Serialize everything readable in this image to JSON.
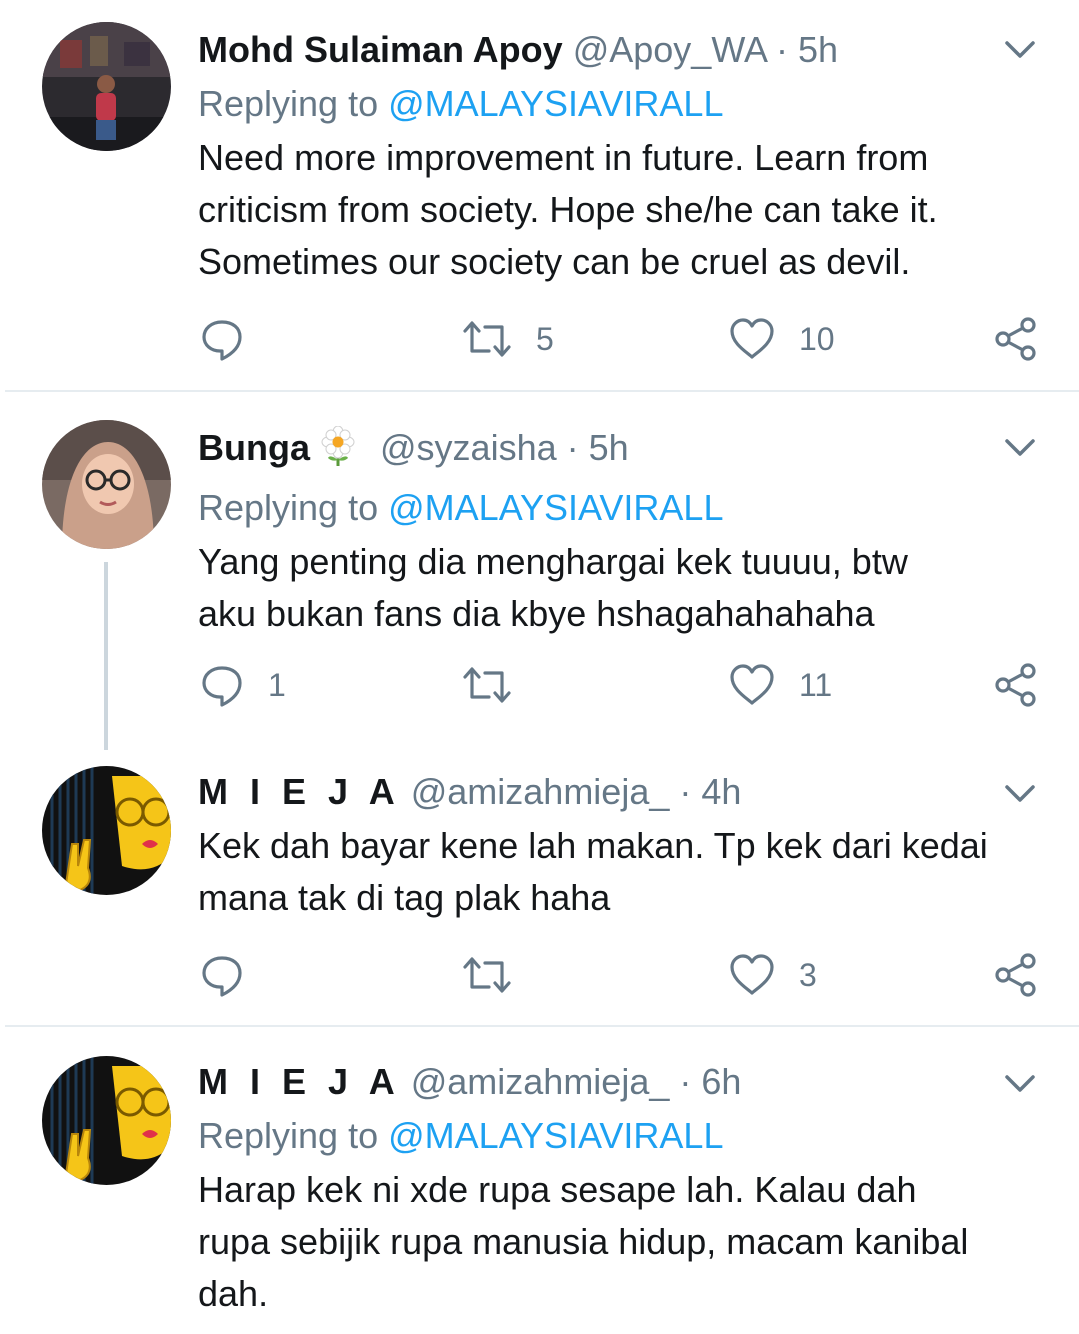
{
  "tweets": [
    {
      "name": "Mohd Sulaiman Apoy",
      "handle": "@Apoy_WA",
      "sep": "·",
      "time": "5h",
      "replying_prefix": "Replying to",
      "replying_handle": "@MALAYSIAVIRALL",
      "lines": [
        "Need more improvement in future. Learn from",
        "criticism from society. Hope she/he can take it.",
        "Sometimes our society can be cruel as devil."
      ],
      "reply_count": "",
      "retweet_count": "5",
      "like_count": "10"
    },
    {
      "name": "Bunga",
      "handle": "@syzaisha",
      "sep": "·",
      "time": "5h",
      "replying_prefix": "Replying to",
      "replying_handle": "@MALAYSIAVIRALL",
      "lines": [
        "Yang penting dia menghargai kek tuuuu, btw",
        "aku bukan fans dia kbye hshagahahahaha"
      ],
      "reply_count": "1",
      "retweet_count": "",
      "like_count": "11"
    },
    {
      "name": "M I E J A",
      "handle": "@amizahmieja_",
      "sep": "·",
      "time": "4h",
      "lines": [
        "Kek dah bayar kene lah makan. Tp kek dari kedai",
        "mana tak di tag plak haha"
      ],
      "reply_count": "",
      "retweet_count": "",
      "like_count": "3"
    },
    {
      "name": "M I E J A",
      "handle": "@amizahmieja_",
      "sep": "·",
      "time": "6h",
      "replying_prefix": "Replying to",
      "replying_handle": "@MALAYSIAVIRALL",
      "lines": [
        "Harap kek ni xde rupa sesape lah. Kalau dah",
        "rupa sebijik rupa manusia hidup, macam kanibal",
        "dah."
      ]
    }
  ],
  "colors": {
    "link": "#1da1f2",
    "muted": "#657786",
    "text": "#14171a",
    "divider": "#e6ecf0",
    "thread_line": "#ccd6dd"
  },
  "icons": [
    "chevron-down-icon",
    "reply-icon",
    "retweet-icon",
    "like-icon",
    "share-icon",
    "flower-emoji"
  ]
}
